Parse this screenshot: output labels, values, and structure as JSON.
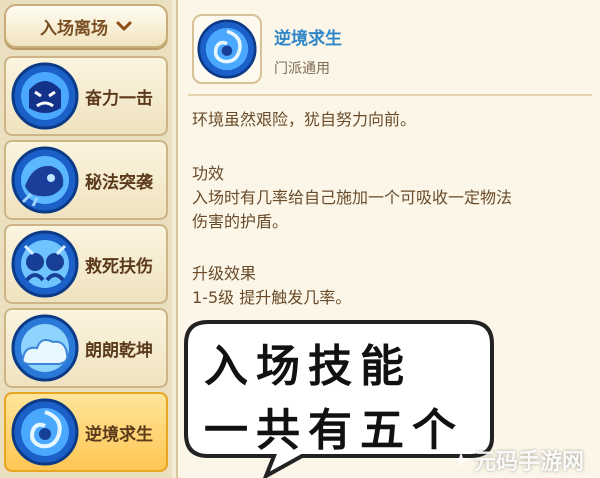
{
  "dropdown": {
    "label": "入场离场",
    "icon": "chevron-down-icon"
  },
  "skills": [
    {
      "name": "奋力一击",
      "icon": "angry-spirit-icon"
    },
    {
      "name": "秘法突袭",
      "icon": "magic-beast-icon"
    },
    {
      "name": "救死扶伤",
      "icon": "twin-spirits-icon"
    },
    {
      "name": "朗朗乾坤",
      "icon": "cloud-icon"
    },
    {
      "name": "逆境求生",
      "icon": "swirl-shield-icon",
      "selected": true
    }
  ],
  "detail": {
    "title": "逆境求生",
    "subtitle": "门派通用",
    "flavor": "环境虽然艰险，犹自努力向前。",
    "effect_heading": "功效",
    "effect_line1": "入场时有几率给自己施加一个可吸收一定物法",
    "effect_line2": "伤害的护盾。",
    "upgrade_heading": "升级效果",
    "upgrade_line1": "1-5级 提升触发几率。"
  },
  "bubble": {
    "line1": "入场技能",
    "line2": "一共有五个"
  },
  "watermark": {
    "text": "元码手游网",
    "icon": "sparkle-icon"
  },
  "colors": {
    "title_blue": "#2f86c8",
    "selected_bg": "#ffc653",
    "icon_blue": "#1e6ed6"
  }
}
